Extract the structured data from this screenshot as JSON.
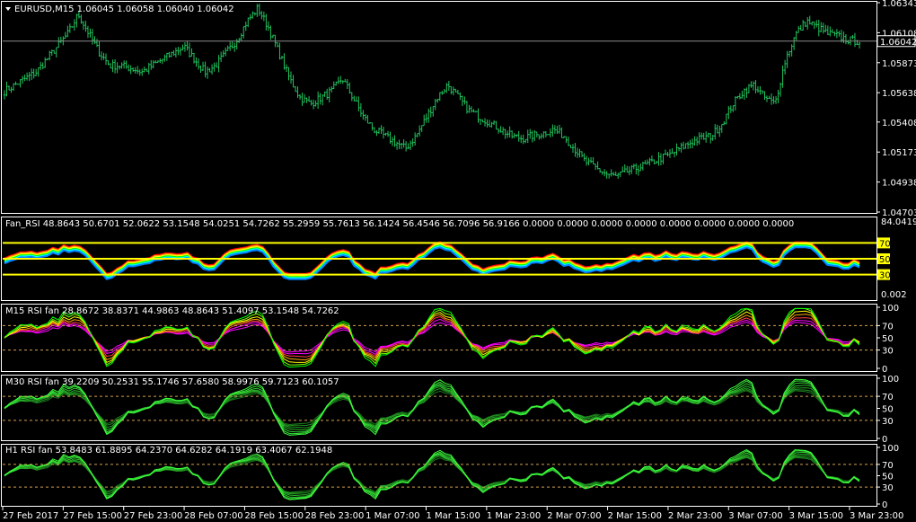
{
  "chart_data": [
    {
      "type": "bar",
      "title": "EURUSD,M15  1.06045 1.06058 1.06040 1.06042",
      "yticks": [
        "1.06343",
        "1.06108",
        "1.05873",
        "1.05638",
        "1.05408",
        "1.05173",
        "1.04938",
        "1.04703"
      ],
      "yvalues": [
        1.06343,
        1.06108,
        1.05873,
        1.05638,
        1.05408,
        1.05173,
        1.04938,
        1.04703
      ],
      "ylim": [
        1.04703,
        1.06343
      ],
      "current_price": "1.06042",
      "current_value": 1.06042,
      "bar_color": "#22c55e",
      "xticks": [
        "27 Feb 2017",
        "27 Feb 15:00",
        "27 Feb 23:00",
        "28 Feb 07:00",
        "28 Feb 15:00",
        "28 Feb 23:00",
        "1 Mar 07:00",
        "1 Mar 15:00",
        "1 Mar 23:00",
        "2 Mar 07:00",
        "2 Mar 15:00",
        "2 Mar 23:00",
        "3 Mar 07:00",
        "3 Mar 15:00",
        "3 Mar 23:00"
      ],
      "close_profile": [
        1.0565,
        1.057,
        1.0575,
        1.058,
        1.059,
        1.06,
        1.061,
        1.0625,
        1.061,
        1.0595,
        1.0585,
        1.0585,
        1.0583,
        1.058,
        1.0585,
        1.059,
        1.0595,
        1.06,
        1.059,
        1.058,
        1.0585,
        1.0595,
        1.0605,
        1.062,
        1.063,
        1.0615,
        1.0595,
        1.0575,
        1.056,
        1.0555,
        1.056,
        1.0565,
        1.0575,
        1.056,
        1.0545,
        1.0535,
        1.053,
        1.0525,
        1.052,
        1.053,
        1.0545,
        1.056,
        1.057,
        1.056,
        1.055,
        1.0545,
        1.054,
        1.0535,
        1.053,
        1.0528,
        1.053,
        1.0532,
        1.0535,
        1.053,
        1.052,
        1.051,
        1.0505,
        1.05,
        1.0498,
        1.0502,
        1.0505,
        1.0508,
        1.0512,
        1.0515,
        1.052,
        1.0525,
        1.0528,
        1.053,
        1.054,
        1.0555,
        1.0565,
        1.057,
        1.056,
        1.0555,
        1.059,
        1.061,
        1.062,
        1.0615,
        1.061,
        1.0608,
        1.0605,
        1.0604
      ]
    },
    {
      "type": "line",
      "title": "Fan_RSI 48.8643 50.6701 52.0622 53.1548 54.0251 54.7262 55.2959 55.7613 56.1424 56.4546 56.7096 56.9166 0.0000 0.0000 0.0000 0.0000 0.0000 0.0000 0.0000 0.0000",
      "ymax_label": "84.0419",
      "ymin_label": "0.002",
      "levels": [
        70,
        50,
        30
      ],
      "level_labels": [
        "70",
        "50",
        "30"
      ],
      "level_color": "#ffff00",
      "series_colors": [
        "#ff0000",
        "#ffa500",
        "#ffff00",
        "#00ff00",
        "#00ffff",
        "#0080ff"
      ],
      "ylim": [
        0,
        100
      ]
    },
    {
      "type": "line",
      "title": "M15 RSI fan 28.8672 38.8371 44.9863 48.8643 51.4097 53.1548 54.7262",
      "yticks": [
        "100",
        "70",
        "50",
        "30",
        "0"
      ],
      "yvalues": [
        100,
        70,
        50,
        30,
        0
      ],
      "levels": [
        70,
        30
      ],
      "series_colors": [
        "#ff00ff",
        "#ff00ff",
        "#ff4040",
        "#ffa500",
        "#ffff00",
        "#80ff00",
        "#00ff00"
      ],
      "ylim": [
        0,
        100
      ]
    },
    {
      "type": "line",
      "title": "M30 RSI fan 39.2209 50.2531 55.1746 57.6580 58.9976 59.7123 60.1057",
      "yticks": [
        "100",
        "70",
        "50",
        "30",
        "0"
      ],
      "yvalues": [
        100,
        70,
        50,
        30,
        0
      ],
      "levels": [
        70,
        30
      ],
      "series_colors": [
        "#1a7a1a",
        "#1f8f1f",
        "#25a525",
        "#2bbb2b",
        "#31d131",
        "#37e737",
        "#3dff3d"
      ],
      "ylim": [
        0,
        100
      ]
    },
    {
      "type": "line",
      "title": "H1 RSI fan 53.8483 61.8895 64.2370 64.6282 64.1919 63.4067 62.1948",
      "yticks": [
        "100",
        "70",
        "50",
        "30",
        "0"
      ],
      "yvalues": [
        100,
        70,
        50,
        30,
        0
      ],
      "levels": [
        70,
        30
      ],
      "series_colors": [
        "#1a7a1a",
        "#1f8f1f",
        "#25a525",
        "#2bbb2b",
        "#31d131",
        "#37e737",
        "#3dff3d"
      ],
      "ylim": [
        0,
        100
      ]
    }
  ]
}
